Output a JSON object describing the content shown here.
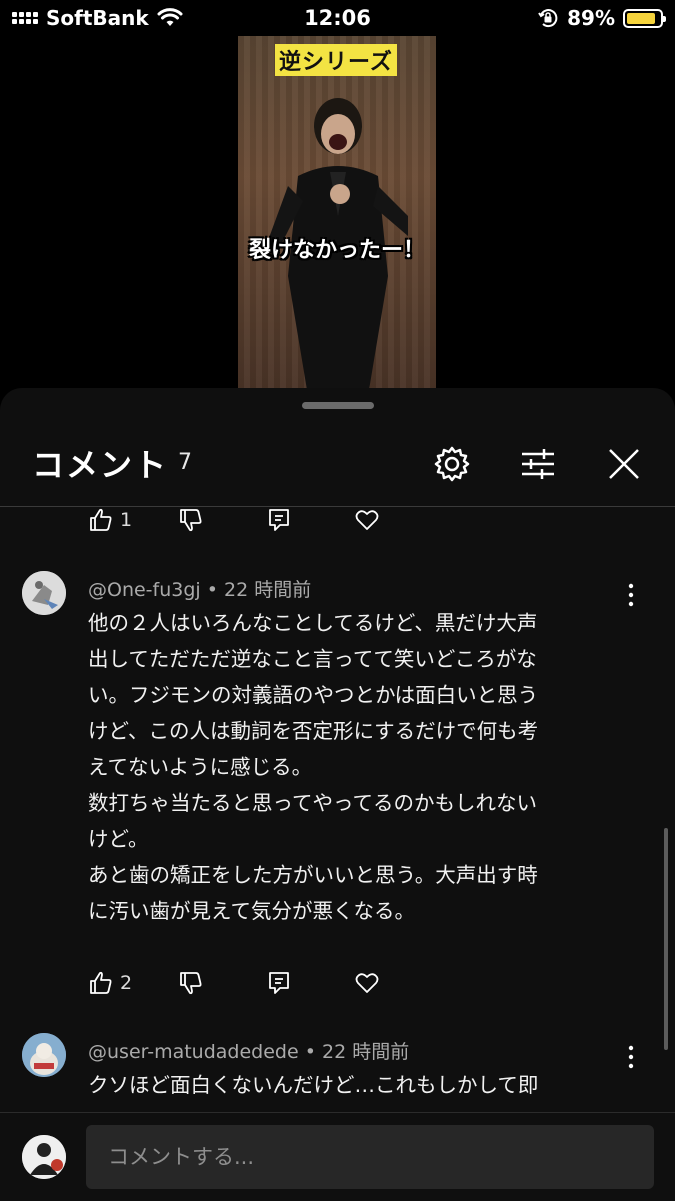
{
  "status_bar": {
    "carrier": "SoftBank",
    "time": "12:06",
    "battery": "89%",
    "battery_level": 0.89
  },
  "video": {
    "title": "逆シリーズ",
    "caption": "裂けなかったー！"
  },
  "comments_panel": {
    "title": "コメント",
    "count": "7",
    "icons": [
      "gear-icon",
      "sliders-icon",
      "close-icon"
    ],
    "input_placeholder": "コメントする..."
  },
  "comments": [
    {
      "likes": "1"
    },
    {
      "author": "@One-fu3gj",
      "time": "22 時間前",
      "text": "他の２人はいろんなことしてるけど、黒だけ大声\n出してただただ逆なこと言ってて笑いどころがな\nい。フジモンの対義語のやつとかは面白いと思う\nけど、この人は動詞を否定形にするだけで何も考\nえてないように感じる。\n数打ちゃ当たると思ってやってるのかもしれない\nけど。\nあと歯の矯正をした方がいいと思う。大声出す時\nに汚い歯が見えて気分が悪くなる。",
      "likes": "2"
    },
    {
      "author": "@user-matudadedede",
      "time": "22 時間前",
      "text": "クソほど面白くないんだけど…これもしかして即"
    }
  ],
  "separator": "•"
}
